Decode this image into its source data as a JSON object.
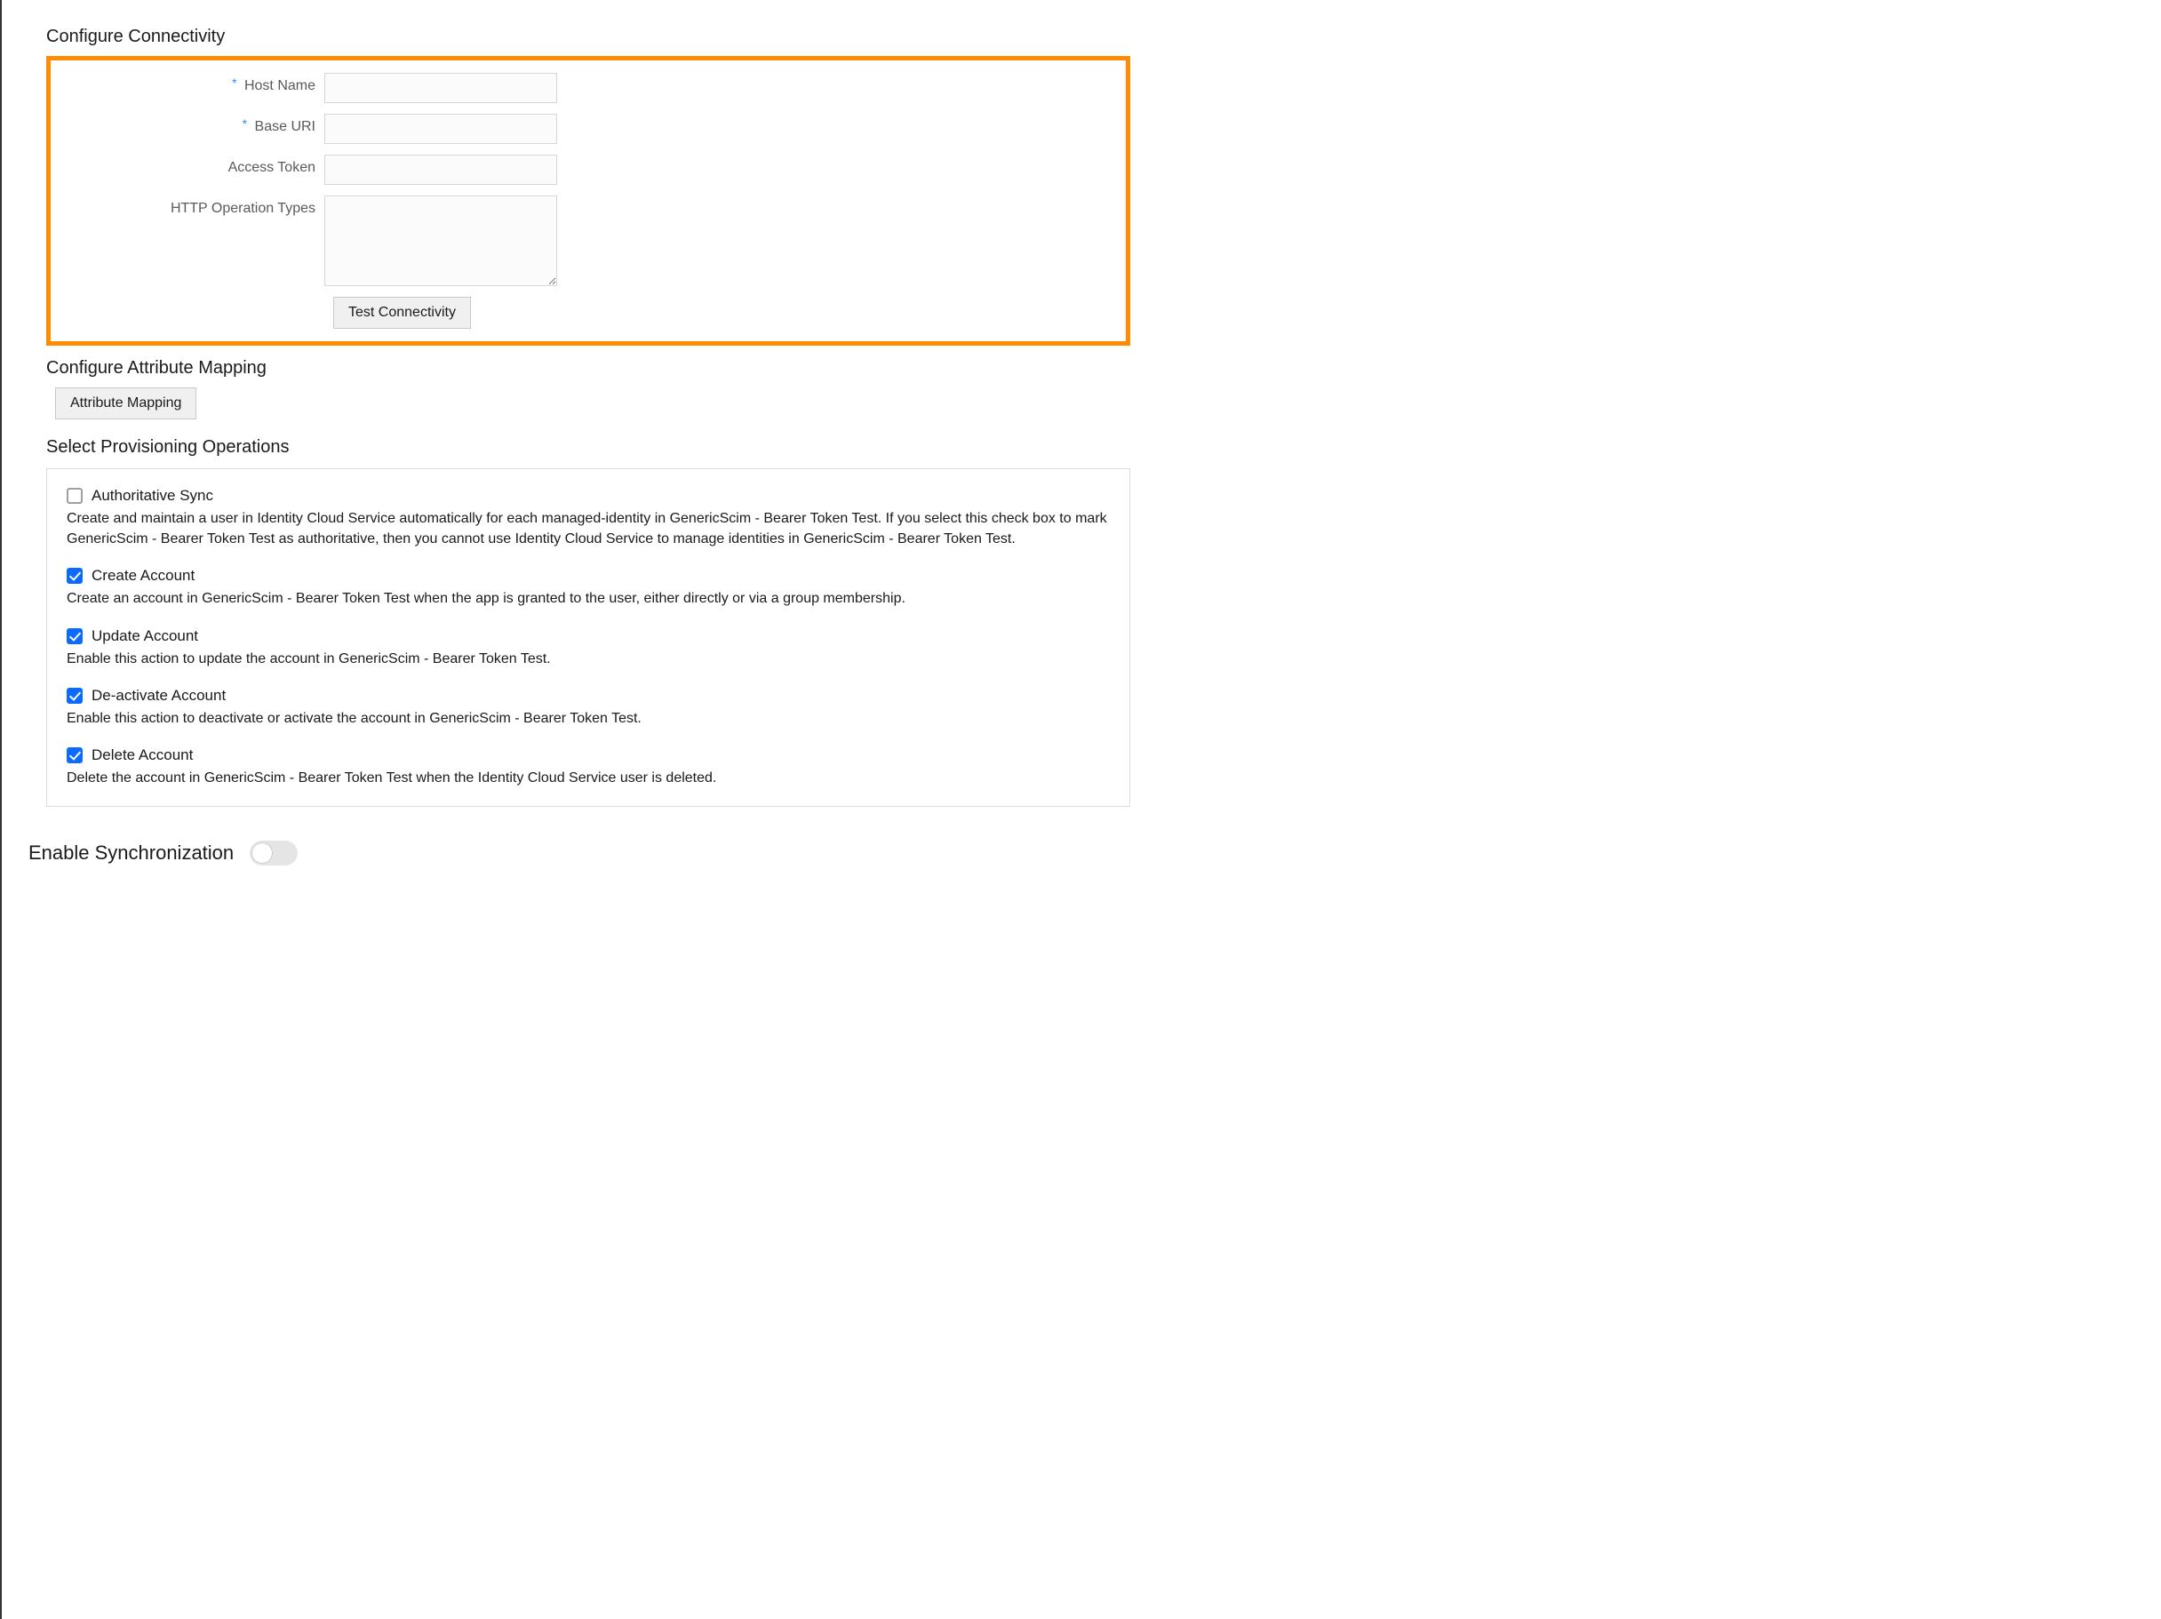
{
  "connectivity": {
    "title": "Configure Connectivity",
    "fields": {
      "hostName": {
        "label": "Host Name",
        "required": true,
        "value": ""
      },
      "baseUri": {
        "label": "Base URI",
        "required": true,
        "value": ""
      },
      "accessToken": {
        "label": "Access Token",
        "required": false,
        "value": ""
      },
      "httpOps": {
        "label": "HTTP Operation Types",
        "required": false,
        "value": ""
      }
    },
    "testButton": "Test Connectivity"
  },
  "attributeMapping": {
    "title": "Configure Attribute Mapping",
    "button": "Attribute Mapping"
  },
  "provisioning": {
    "title": "Select Provisioning Operations",
    "ops": [
      {
        "key": "authoritative-sync",
        "label": "Authoritative Sync",
        "checked": false,
        "desc": "Create and maintain a user in Identity Cloud Service automatically for each managed-identity in GenericScim - Bearer Token Test. If you select this check box to mark GenericScim - Bearer Token Test as authoritative, then you cannot use Identity Cloud Service to manage identities in GenericScim - Bearer Token Test."
      },
      {
        "key": "create-account",
        "label": "Create Account",
        "checked": true,
        "desc": "Create an account in GenericScim - Bearer Token Test when the app is granted to the user, either directly or via a group membership."
      },
      {
        "key": "update-account",
        "label": "Update Account",
        "checked": true,
        "desc": "Enable this action to update the account in GenericScim - Bearer Token Test."
      },
      {
        "key": "deactivate-account",
        "label": "De-activate Account",
        "checked": true,
        "desc": "Enable this action to deactivate or activate the account in GenericScim - Bearer Token Test."
      },
      {
        "key": "delete-account",
        "label": "Delete Account",
        "checked": true,
        "desc": "Delete the account in GenericScim - Bearer Token Test when the Identity Cloud Service user is deleted."
      }
    ]
  },
  "sync": {
    "label": "Enable Synchronization",
    "enabled": false
  },
  "requiredMark": "*"
}
